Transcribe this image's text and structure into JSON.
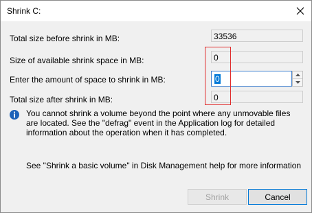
{
  "window": {
    "title": "Shrink C:"
  },
  "rows": {
    "total_before": {
      "label": "Total size before shrink in MB:",
      "value": "33536"
    },
    "available": {
      "label": "Size of available shrink space in MB:",
      "value": "0"
    },
    "amount": {
      "label": "Enter the amount of space to shrink in MB:",
      "value": "0"
    },
    "total_after": {
      "label": "Total size after shrink in MB:",
      "value": "0"
    }
  },
  "info": {
    "text": "You cannot shrink a volume beyond the point where any unmovable files are located. See the \"defrag\" event in the Application log for detailed information about the operation when it has completed."
  },
  "help_text": "See \"Shrink a basic volume\" in Disk Management help for more information",
  "buttons": {
    "shrink": "Shrink",
    "cancel": "Cancel"
  },
  "colors": {
    "highlight": "#e02a2a",
    "accent": "#0078d7",
    "info_icon": "#1c62b9"
  },
  "icons": {
    "close": "close-icon",
    "info": "info-icon",
    "spin_up": "chevron-up-icon",
    "spin_down": "chevron-down-icon"
  }
}
